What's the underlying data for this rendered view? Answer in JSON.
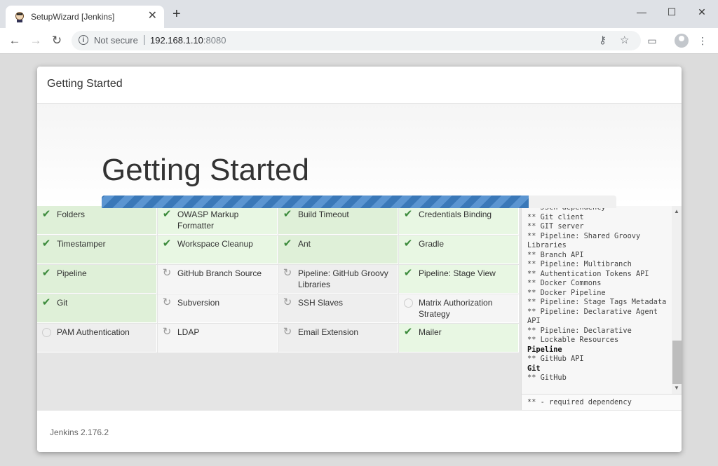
{
  "browser": {
    "tab_title": "SetupWizard [Jenkins]",
    "tab_close": "✕",
    "new_tab": "+",
    "security_label": "Not secure",
    "url_host": "192.168.1.10",
    "url_port": ":8080",
    "window_controls": {
      "minimize": "—",
      "maximize": "☐",
      "close": "✕"
    }
  },
  "dialog": {
    "header_title": "Getting Started",
    "hero_title": "Getting Started",
    "progress": 0.83,
    "footer_version": "Jenkins 2.176.2"
  },
  "plugins": [
    {
      "label": "Folders",
      "status": "done"
    },
    {
      "label": "OWASP Markup Formatter",
      "status": "done"
    },
    {
      "label": "Build Timeout",
      "status": "done"
    },
    {
      "label": "Credentials Binding",
      "status": "done"
    },
    {
      "label": "Timestamper",
      "status": "done"
    },
    {
      "label": "Workspace Cleanup",
      "status": "done"
    },
    {
      "label": "Ant",
      "status": "done"
    },
    {
      "label": "Gradle",
      "status": "done"
    },
    {
      "label": "Pipeline",
      "status": "done"
    },
    {
      "label": "GitHub Branch Source",
      "status": "loading"
    },
    {
      "label": "Pipeline: GitHub Groovy Libraries",
      "status": "loading"
    },
    {
      "label": "Pipeline: Stage View",
      "status": "done"
    },
    {
      "label": "Git",
      "status": "done"
    },
    {
      "label": "Subversion",
      "status": "loading"
    },
    {
      "label": "SSH Slaves",
      "status": "loading"
    },
    {
      "label": "Matrix Authorization Strategy",
      "status": "pending"
    },
    {
      "label": "PAM Authentication",
      "status": "pending"
    },
    {
      "label": "LDAP",
      "status": "loading"
    },
    {
      "label": "Email Extension",
      "status": "loading"
    },
    {
      "label": "Mailer",
      "status": "done"
    }
  ],
  "log": {
    "lines": [
      {
        "text": "** JSch dependency",
        "strong": false
      },
      {
        "text": "** Git client",
        "strong": false
      },
      {
        "text": "** GIT server",
        "strong": false
      },
      {
        "text": "** Pipeline: Shared Groovy",
        "strong": false
      },
      {
        "text": "Libraries",
        "strong": false
      },
      {
        "text": "** Branch API",
        "strong": false
      },
      {
        "text": "** Pipeline: Multibranch",
        "strong": false
      },
      {
        "text": "** Authentication Tokens API",
        "strong": false
      },
      {
        "text": "** Docker Commons",
        "strong": false
      },
      {
        "text": "** Docker Pipeline",
        "strong": false
      },
      {
        "text": "** Pipeline: Stage Tags Metadata",
        "strong": false
      },
      {
        "text": "** Pipeline: Declarative Agent",
        "strong": false
      },
      {
        "text": "API",
        "strong": false
      },
      {
        "text": "** Pipeline: Declarative",
        "strong": false
      },
      {
        "text": "** Lockable Resources",
        "strong": false
      },
      {
        "text": "Pipeline",
        "strong": true
      },
      {
        "text": "** GitHub API",
        "strong": false
      },
      {
        "text": "Git",
        "strong": true
      },
      {
        "text": "** GitHub",
        "strong": false
      }
    ],
    "footer": "** - required dependency"
  },
  "colors": {
    "done_bg": "#dff0d8",
    "check": "#3c8b3c",
    "progress": "#3a78b8"
  }
}
